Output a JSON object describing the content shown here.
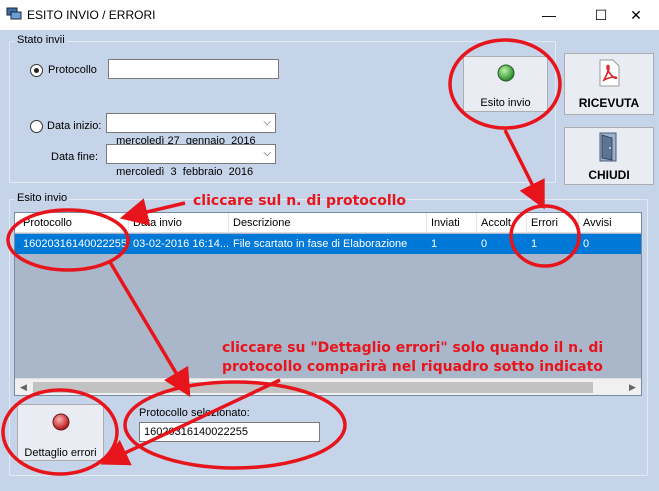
{
  "window": {
    "title": "ESITO INVIO / ERRORI",
    "min": "—",
    "max": "☐",
    "close": "✕"
  },
  "stato": {
    "group_label": "Stato invii",
    "protocollo_label": "Protocollo",
    "protocollo_value": "",
    "data_inizio_label": "Data inizio:",
    "data_inizio_value": "mercoledì 27  gennaio  2016",
    "data_fine_label": "Data fine:",
    "data_fine_value": "mercoledì  3  febbraio  2016",
    "selected": "protocollo"
  },
  "buttons": {
    "esito_invio": "Esito invio",
    "ricevuta": "RICEVUTA",
    "chiudi": "CHIUDI",
    "dettaglio_errori": "Dettaglio errori"
  },
  "esito": {
    "group_label": "Esito invio",
    "columns": [
      "Protocollo",
      "Data invio",
      "Descrizione",
      "Inviati",
      "Accolt",
      "Errori",
      "Avvisi"
    ],
    "rows": [
      [
        "16020316140022255",
        "03-02-2016 16:14...",
        "File scartato in fase di Elaborazione",
        "1",
        "0",
        "1",
        "0"
      ]
    ]
  },
  "selezionato": {
    "label": "Protocollo selezionato:",
    "value": "16020316140022255"
  },
  "annotations": {
    "a1": "cliccare sul n. di protocollo",
    "a2_line1": "cliccare su \"Dettaglio errori\" solo quando il n. di",
    "a2_line2": "protocollo comparirà nel riquadro sotto indicato"
  },
  "colors": {
    "background": "#c5d4e8",
    "selection": "#0078d7",
    "annotation": "#e8141c",
    "led": "#3ea83e",
    "led_red": "#d62a2a"
  }
}
